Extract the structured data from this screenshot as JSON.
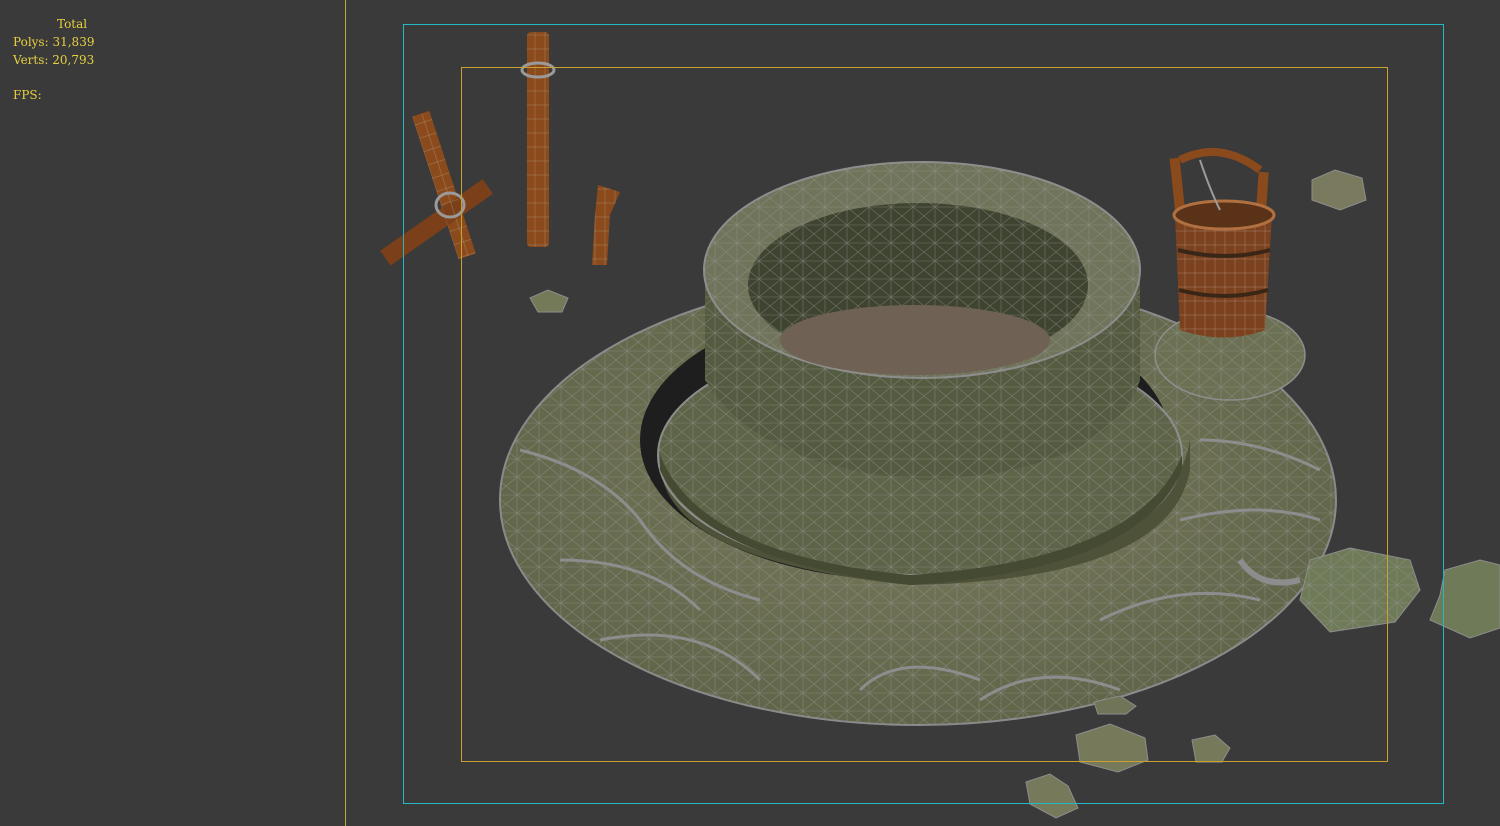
{
  "viewport": {
    "stats": {
      "title": "Total",
      "polys_label": "Polys:",
      "polys_value": "31,839",
      "verts_label": "Verts:",
      "verts_value": "20,793",
      "fps_label": "FPS:",
      "fps_value": ""
    },
    "colors": {
      "background": "#3a3a3a",
      "stats_text": "#e7d040",
      "divider": "#c8a832",
      "safe_frame_outer": "#22b9c5",
      "safe_frame_inner": "#c9a12e",
      "stone": "#6f7556",
      "wood": "#8a4a1c",
      "wire": "#9a9a9a"
    }
  }
}
